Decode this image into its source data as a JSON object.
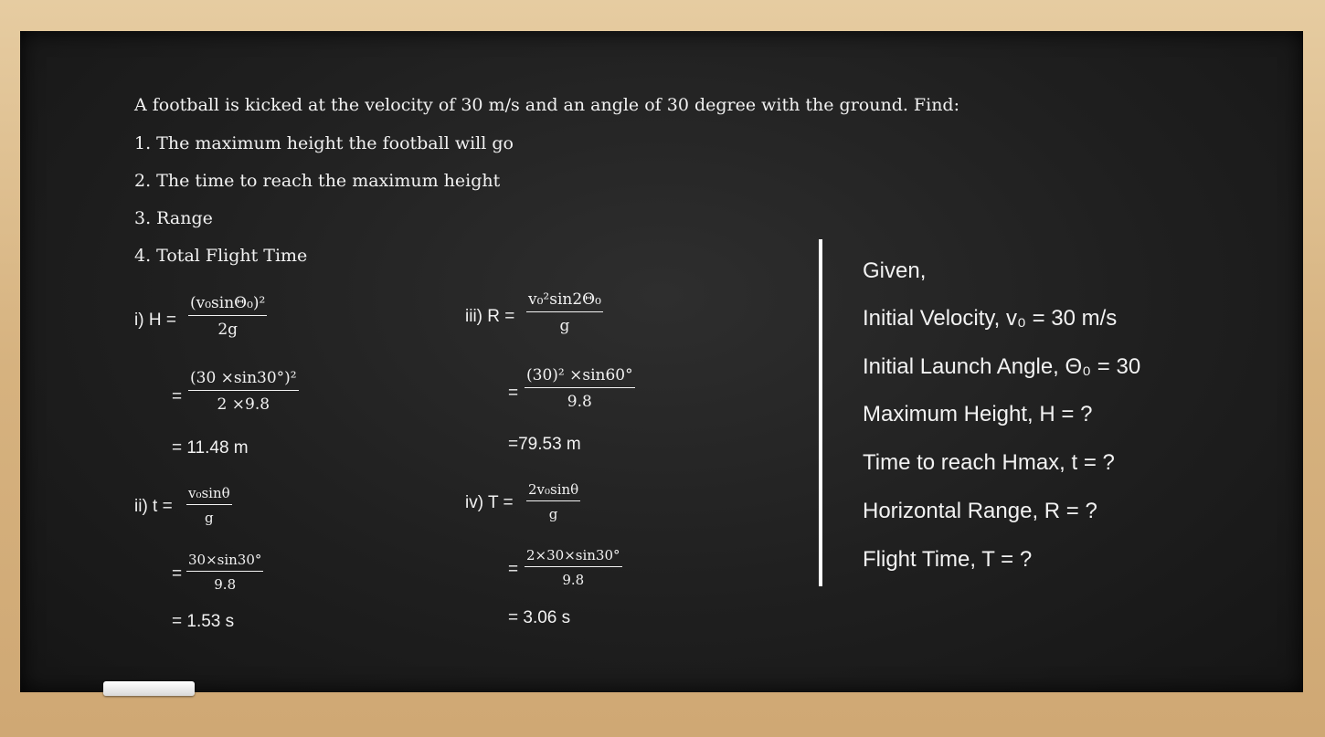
{
  "problem": {
    "statement": "A football is kicked at the velocity of 30 m/s and an angle of 30 degree with the ground. Find:",
    "items": [
      "1. The maximum height the football will go",
      "2. The time to reach the maximum height",
      "3. Range",
      "4. Total Flight Time"
    ]
  },
  "solutions": {
    "h": {
      "label": "i) H =",
      "num": "(v₀sinΘ₀)²",
      "den": "2g",
      "sub_eq": "=",
      "sub_num": "(30 ×sin30°)²",
      "sub_den": "2 ×9.8",
      "result": "= 11.48 m"
    },
    "t": {
      "label": "ii) t =",
      "num": "v₀sinθ",
      "den": "g",
      "sub_eq": "=",
      "sub_num": "30×sin30°",
      "sub_den": "9.8",
      "result": "= 1.53 s"
    },
    "r": {
      "label": "iii) R =",
      "num": "v₀²sin2Θ₀",
      "den": "g",
      "sub_eq": "=",
      "sub_num": "(30)² ×sin60°",
      "sub_den": "9.8",
      "result": "=79.53 m"
    },
    "ft": {
      "label": "iv) T =",
      "num": "2v₀sinθ",
      "den": "g",
      "sub_eq": "=",
      "sub_num": "2×30×sin30°",
      "sub_den": "9.8",
      "result": "= 3.06 s"
    }
  },
  "given": {
    "title": "Given,",
    "lines": [
      "Initial Velocity, v₀ = 30 m/s",
      "Initial Launch Angle, Θ₀ = 30",
      "Maximum Height, H = ?",
      "Time to reach Hmax, t = ?",
      "Horizontal Range, R = ?",
      "Flight Time, T = ?"
    ]
  }
}
